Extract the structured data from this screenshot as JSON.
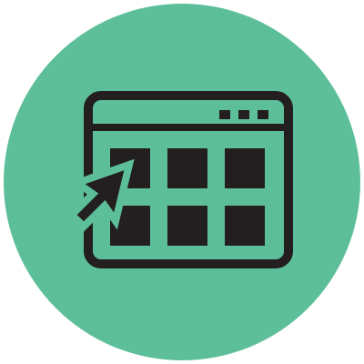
{
  "icon": {
    "subject": "app-window-grid-with-cursor",
    "elements": {
      "circle": "circle-badge",
      "window": "browser-window-icon",
      "window_controls": [
        "window-dot-icon",
        "window-dot-icon",
        "window-dot-icon"
      ],
      "grid": "app-grid-icon",
      "cursor": "mouse-pointer-icon"
    }
  },
  "colors": {
    "background": "#ffffff",
    "circle": "#5dbf99",
    "ink": "#231f20"
  }
}
